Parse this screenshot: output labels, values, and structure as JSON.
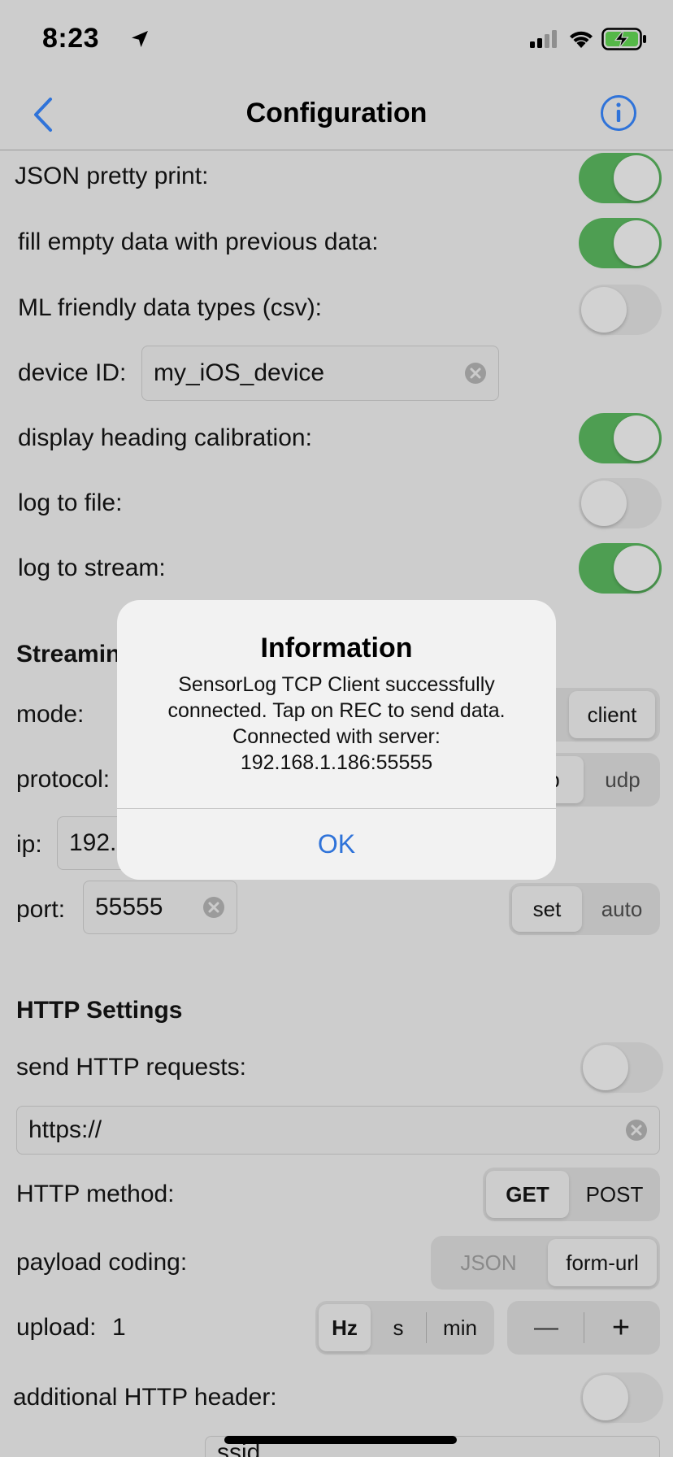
{
  "status_bar": {
    "time": "8:23",
    "icons": [
      "location-arrow-icon",
      "cellular-signal-icon",
      "wifi-icon",
      "battery-charging-icon"
    ]
  },
  "nav": {
    "back_icon": "chevron-left-icon",
    "title": "Configuration",
    "info_icon": "info-circle-icon"
  },
  "settings": {
    "json_pretty_print": {
      "label": "JSON pretty print:",
      "on": true
    },
    "fill_empty": {
      "label": "fill empty data with previous data:",
      "on": true
    },
    "ml_friendly": {
      "label": "ML friendly data types (csv):",
      "on": false
    },
    "device_id": {
      "label": "device ID:",
      "value": "my_iOS_device"
    },
    "heading_calibration": {
      "label": "display heading calibration:",
      "on": true
    },
    "log_to_file": {
      "label": "log to file:",
      "on": false
    },
    "log_to_stream": {
      "label": "log to stream:",
      "on": true
    }
  },
  "streaming": {
    "section_title_visible": "Streamin",
    "mode": {
      "label": "mode:",
      "options": [
        "client"
      ],
      "selected": "client"
    },
    "protocol": {
      "label": "protocol:",
      "options": [
        "cp",
        "udp"
      ],
      "selected": "cp"
    },
    "ip": {
      "label": "ip:",
      "value_visible": "192.1"
    },
    "port": {
      "label": "port:",
      "value": "55555",
      "options": [
        "set",
        "auto"
      ],
      "selected": "set"
    }
  },
  "http": {
    "section_title": "HTTP Settings",
    "send_requests": {
      "label": "send HTTP requests:",
      "on": false
    },
    "url": {
      "value": "https://"
    },
    "method": {
      "label": "HTTP method:",
      "options": [
        "GET",
        "POST"
      ],
      "selected": "GET"
    },
    "payload": {
      "label": "payload coding:",
      "options": [
        "JSON",
        "form-url"
      ],
      "selected": "form-url"
    },
    "upload": {
      "label": "upload:",
      "value": "1",
      "units": [
        "Hz",
        "s",
        "min"
      ],
      "selected_unit": "Hz",
      "minus": "—",
      "plus": "+"
    },
    "additional_header": {
      "label": "additional HTTP header:",
      "on": false
    },
    "header_field_partial": "ssid"
  },
  "dialog": {
    "title": "Information",
    "message_lines": [
      "SensorLog TCP Client successfully",
      "connected. Tap on REC to send data.",
      "Connected with server:",
      "192.168.1.186:55555"
    ],
    "ok_label": "OK"
  },
  "colors": {
    "toggle_on": "#4e9e52",
    "accent_blue": "#2f73d9",
    "background": "#cdcdcd",
    "dialog_bg": "#f2f2f2"
  }
}
